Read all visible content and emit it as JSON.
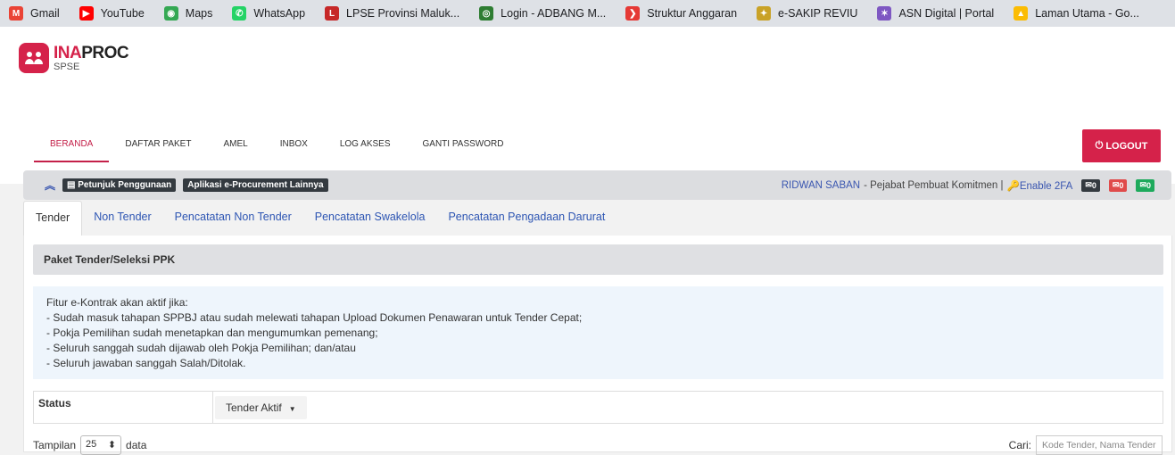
{
  "bookmarks": [
    {
      "label": "Gmail",
      "icon": "gmail-icon",
      "color": "#ea4335",
      "glyph": "M"
    },
    {
      "label": "YouTube",
      "icon": "youtube-icon",
      "color": "#ff0000",
      "glyph": "▶"
    },
    {
      "label": "Maps",
      "icon": "maps-icon",
      "color": "#34a853",
      "glyph": "◉"
    },
    {
      "label": "WhatsApp",
      "icon": "whatsapp-icon",
      "color": "#25d366",
      "glyph": "✆"
    },
    {
      "label": "LPSE Provinsi Maluk...",
      "icon": "lpse-icon",
      "color": "#c62828",
      "glyph": "L"
    },
    {
      "label": "Login - ADBANG M...",
      "icon": "adbang-icon",
      "color": "#2e7d32",
      "glyph": "◎"
    },
    {
      "label": "Struktur Anggaran",
      "icon": "struktur-icon",
      "color": "#e53935",
      "glyph": "❯"
    },
    {
      "label": "e-SAKIP REVIU",
      "icon": "garuda-icon",
      "color": "#c9a227",
      "glyph": "✦"
    },
    {
      "label": "ASN Digital | Portal",
      "icon": "asn-icon",
      "color": "#7e57c2",
      "glyph": "✶"
    },
    {
      "label": "Laman Utama - Go...",
      "icon": "drive-icon",
      "color": "#fbbc04",
      "glyph": "▲"
    }
  ],
  "logo": {
    "ina": "INA",
    "proc": "PROC",
    "sub": "SPSE"
  },
  "nav": [
    "BERANDA",
    "DAFTAR PAKET",
    "AMEL",
    "INBOX",
    "LOG AKSES",
    "GANTI PASSWORD"
  ],
  "logout": "LOGOUT",
  "infobar": {
    "petunjuk": "Petunjuk Penggunaan",
    "aplikasi": "Aplikasi e-Procurement Lainnya",
    "user": "RIDWAN SABAN",
    "role": "- Pejabat Pembuat Komitmen |",
    "twofa": "Enable 2FA",
    "badges": [
      "0",
      "0",
      "0"
    ]
  },
  "tabs": [
    "Tender",
    "Non Tender",
    "Pencatatan Non Tender",
    "Pencatatan Swakelola",
    "Pencatatan Pengadaan Darurat"
  ],
  "panel": {
    "title": "Paket Tender/Seleksi PPK",
    "notice": [
      "Fitur e-Kontrak akan aktif jika:",
      "- Sudah masuk tahapan SPPBJ atau sudah melewati tahapan Upload Dokumen Penawaran untuk Tender Cepat;",
      "- Pokja Pemilihan sudah menetapkan dan mengumumkan pemenang;",
      "- Seluruh sanggah sudah dijawab oleh Pokja Pemilihan; dan/atau",
      "- Seluruh jawaban sanggah Salah/Ditolak."
    ],
    "status_label": "Status",
    "status_value": "Tender Aktif",
    "tampilan": "Tampilan",
    "page_size": "25",
    "data": "data",
    "cari": "Cari:",
    "search_placeholder": "Kode Tender, Nama Tender"
  }
}
